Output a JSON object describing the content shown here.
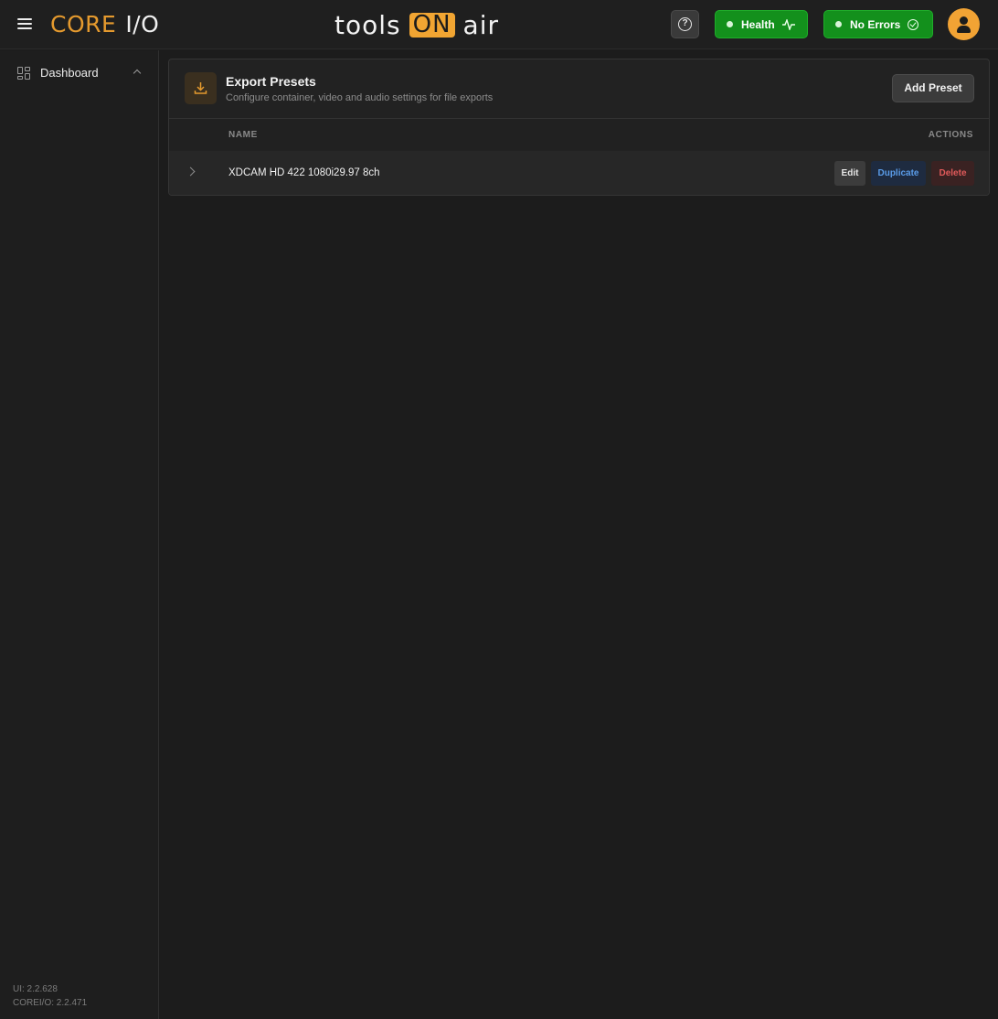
{
  "topbar": {
    "logo_core": "CORE",
    "logo_io": "I/O",
    "brand_left": "tools",
    "brand_on": "ON",
    "brand_right": "air",
    "health_label": "Health",
    "errors_label": "No Errors",
    "status_color": "#13901c",
    "accent_color": "#f1a532"
  },
  "sidebar": {
    "items": [
      {
        "label": "Dashboard",
        "icon": "dashboard-grid-icon",
        "expanded": true
      }
    ],
    "version_ui": "UI: 2.2.628",
    "version_core": "COREI/O: 2.2.471"
  },
  "card": {
    "title": "Export Presets",
    "subtitle": "Configure container, video and audio settings for file exports",
    "add_label": "Add Preset",
    "icon": "download-icon",
    "columns": [
      "NAME",
      "ACTIONS"
    ],
    "rows": [
      {
        "name": "XDCAM HD 422 1080i29.97 8ch",
        "actions": [
          "Edit",
          "Duplicate",
          "Delete"
        ]
      }
    ]
  }
}
